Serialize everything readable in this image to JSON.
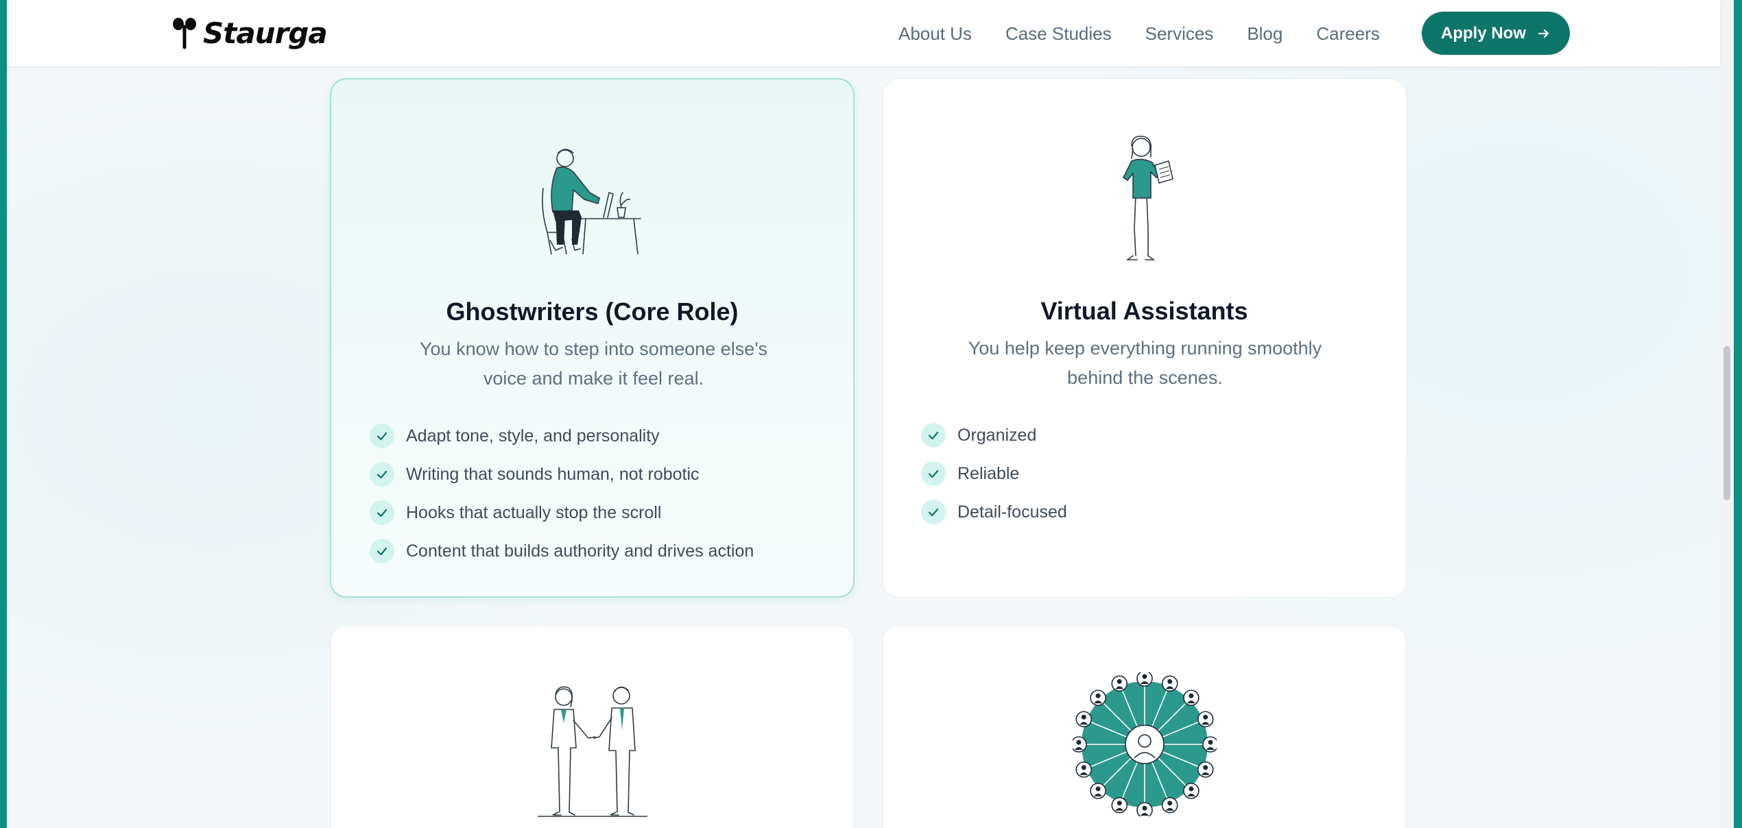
{
  "brand": {
    "name": "Staurga",
    "accent": "#0e7569",
    "frame": "#0f8f80"
  },
  "nav": {
    "items": [
      "About Us",
      "Case Studies",
      "Services",
      "Blog",
      "Careers"
    ],
    "cta": "Apply Now"
  },
  "cards": [
    {
      "title": "Ghostwriters (Core Role)",
      "desc_lines": [
        "You know how to step into someone else's",
        "voice and make it feel real."
      ],
      "features": [
        "Adapt tone, style, and personality",
        "Writing that sounds human, not robotic",
        "Hooks that actually stop the scroll",
        "Content that builds authority and drives action"
      ],
      "illustration": "person-at-desk-illustration"
    },
    {
      "title": "Virtual Assistants",
      "desc_lines": [
        "You help keep everything running smoothly",
        "behind the scenes."
      ],
      "features": [
        "Organized",
        "Reliable",
        "Detail-focused"
      ],
      "illustration": "woman-with-clipboard-illustration"
    },
    {
      "illustration": "handshake-illustration"
    },
    {
      "illustration": "network-circle-illustration"
    }
  ]
}
